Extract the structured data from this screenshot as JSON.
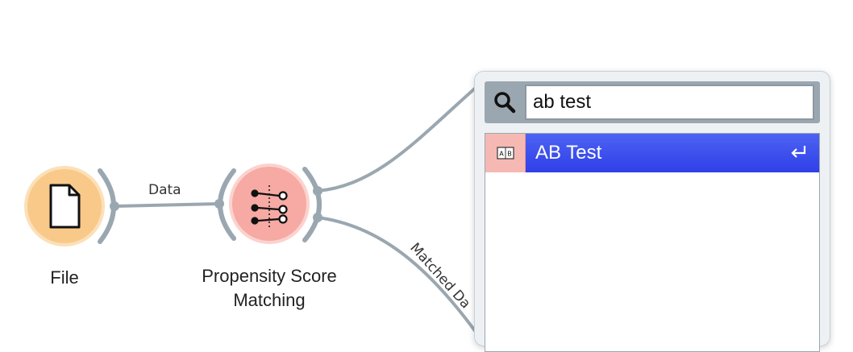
{
  "canvas": {
    "nodes": [
      {
        "id": "file",
        "label": "File",
        "icon": "document-icon",
        "color": "#f9c98a"
      },
      {
        "id": "psm",
        "label_line1": "Propensity Score",
        "label_line2": "Matching",
        "icon": "matching-icon",
        "color": "#f7a9a3"
      }
    ],
    "links": [
      {
        "from": "file",
        "to": "psm",
        "label": "Data"
      },
      {
        "from": "psm",
        "to": "popup",
        "label": ""
      },
      {
        "from": "psm",
        "to": "offscreen",
        "label": "Matched Da"
      }
    ]
  },
  "search": {
    "icon": "search-icon",
    "value": "ab test"
  },
  "results": [
    {
      "label": "AB Test",
      "icon": "ab-test-icon",
      "shortcut_icon": "enter-icon",
      "selected": true
    }
  ],
  "colors": {
    "link": "#9aa7b0",
    "selection": "#3a4cf0",
    "file_node": "#f9c98a",
    "psm_node": "#f7a9a3"
  }
}
